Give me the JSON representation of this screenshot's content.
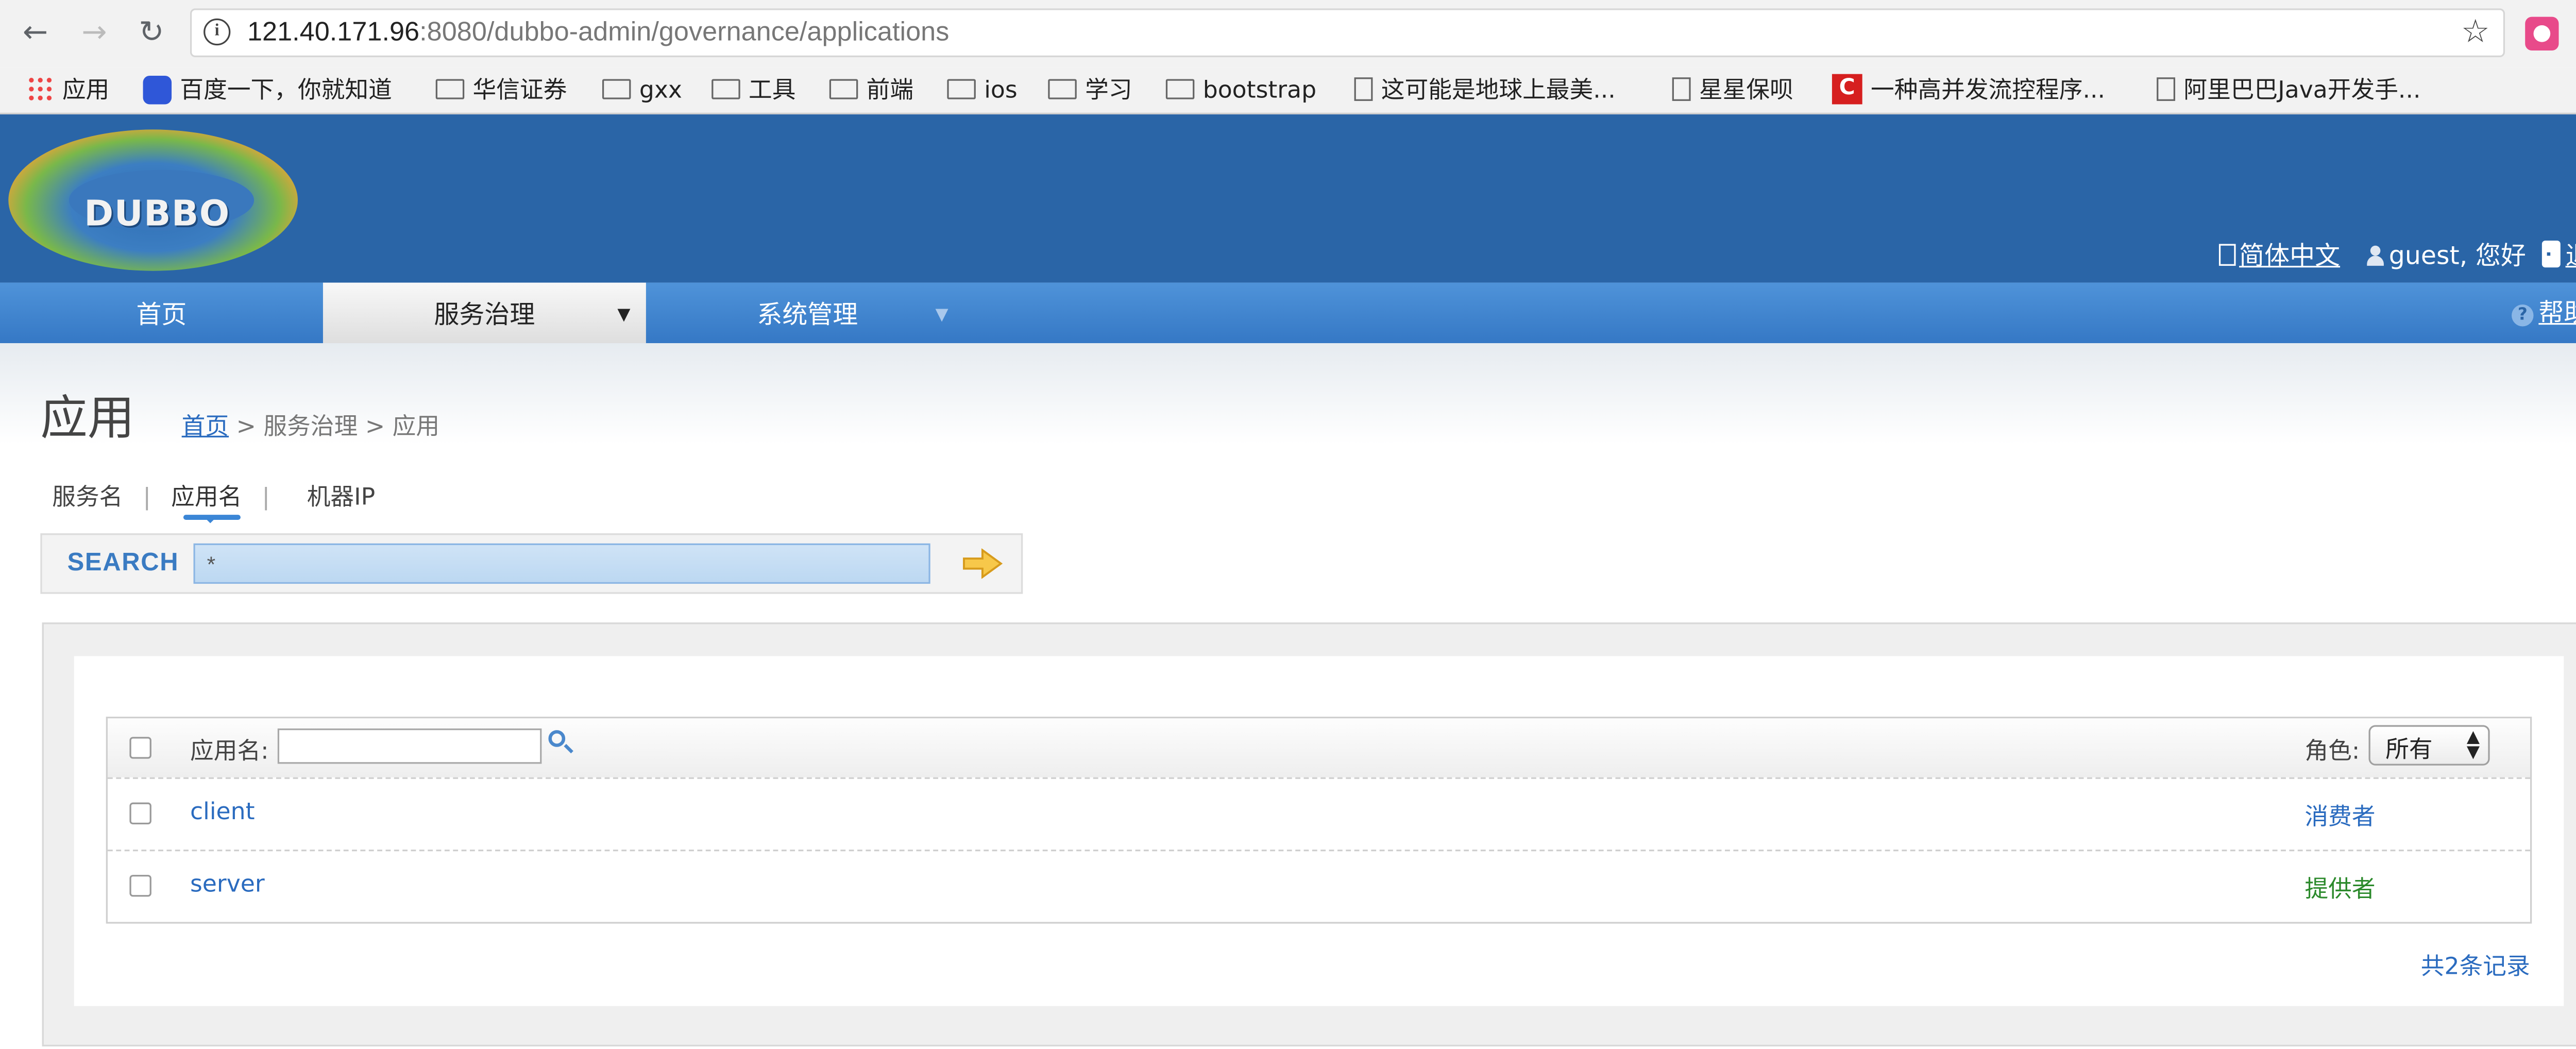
{
  "browser": {
    "url_host": "121.40.171.96",
    "url_rest": ":8080/dubbo-admin/governance/applications",
    "bookmarks": [
      {
        "label": "应用",
        "icon": "apps-grid-icon"
      },
      {
        "label": "百度一下，你就知道",
        "icon": "baidu-icon"
      },
      {
        "label": "华信证券",
        "icon": "folder-icon"
      },
      {
        "label": "gxx",
        "icon": "folder-icon"
      },
      {
        "label": "工具",
        "icon": "folder-icon"
      },
      {
        "label": "前端",
        "icon": "folder-icon"
      },
      {
        "label": "ios",
        "icon": "folder-icon"
      },
      {
        "label": "学习",
        "icon": "folder-icon"
      },
      {
        "label": "bootstrap",
        "icon": "folder-icon"
      },
      {
        "label": "这可能是地球上最美...",
        "icon": "page-icon"
      },
      {
        "label": "星星保呗",
        "icon": "page-icon"
      },
      {
        "label": "一种高并发流控程序...",
        "icon": "c-icon"
      },
      {
        "label": "阿里巴巴Java开发手...",
        "icon": "page-icon"
      }
    ]
  },
  "header": {
    "logo_text": "DUBBO",
    "lang_link": "简体中文",
    "greeting": "guest, 您好",
    "logout": "退出"
  },
  "nav": {
    "home": "首页",
    "governance": "服务治理",
    "system": "系统管理",
    "help": "帮助"
  },
  "page": {
    "title": "应用",
    "breadcrumb_home": "首页",
    "breadcrumb_rest": " > 服务治理 > 应用"
  },
  "tabs": {
    "service": "服务名",
    "application": "应用名",
    "ip": "机器IP"
  },
  "search": {
    "label": "SEARCH",
    "value": "*"
  },
  "table": {
    "name_filter_label": "应用名:",
    "role_label": "角色:",
    "role_selected": "所有",
    "rows": [
      {
        "name": "client",
        "role": "消费者",
        "role_color": "#2a6bbf"
      },
      {
        "name": "server",
        "role": "提供者",
        "role_color": "#2c8a2c"
      }
    ],
    "total": "共2条记录"
  },
  "colors": {
    "header_blue": "#2a65a7",
    "nav_blue": "#3578c5",
    "link_blue": "#2a6bbf"
  }
}
